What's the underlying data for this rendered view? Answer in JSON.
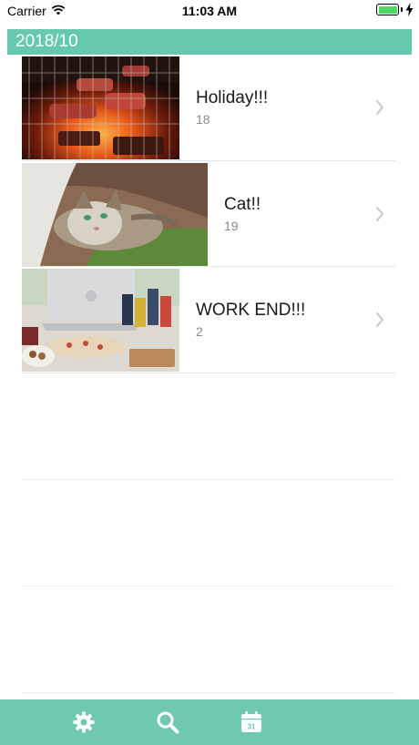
{
  "status": {
    "carrier": "Carrier",
    "time": "11:03 AM",
    "battery_level": 1.0
  },
  "header": {
    "month": "2018/10"
  },
  "albums": [
    {
      "title": "Holiday!!!",
      "count": "18",
      "image": "bbq-grill-photo"
    },
    {
      "title": "Cat!!",
      "count": "19",
      "image": "cat-photo"
    },
    {
      "title": "WORK END!!!",
      "count": "2",
      "image": "laptop-snacks-photo"
    }
  ],
  "tabs": [
    {
      "name": "settings",
      "icon": "gear-icon"
    },
    {
      "name": "search",
      "icon": "search-icon"
    },
    {
      "name": "calendar",
      "icon": "calendar-icon",
      "day": "31"
    }
  ],
  "colors": {
    "accent": "#66c8ad",
    "tab_bar": "#6ec9b0",
    "battery": "#4cd964"
  }
}
